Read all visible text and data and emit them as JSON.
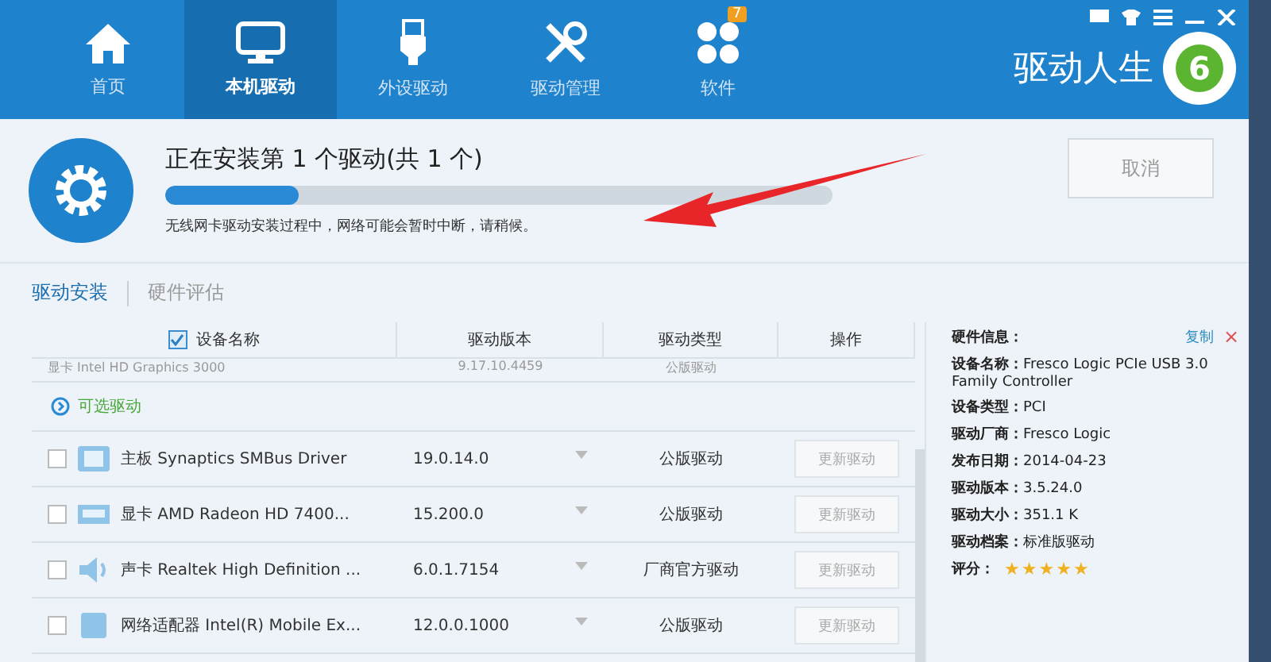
{
  "nav": [
    {
      "label": "首页",
      "kind": "home",
      "selected": false
    },
    {
      "label": "本机驱动",
      "kind": "monitor",
      "selected": true
    },
    {
      "label": "外设驱动",
      "kind": "usb",
      "selected": false
    },
    {
      "label": "驱动管理",
      "kind": "tools",
      "selected": false
    },
    {
      "label": "软件",
      "kind": "apps",
      "selected": false,
      "badge": "7"
    }
  ],
  "brand": {
    "name": "驱动人生",
    "logo_text": "6"
  },
  "install": {
    "title": "正在安装第 1 个驱动(共 1 个)",
    "level": 0.2,
    "note": "无线网卡驱动安装过程中，网络可能会暂时中断，请稍候。",
    "cancel": "取消"
  },
  "tabs": [
    {
      "label": "驱动安装",
      "selected": true
    },
    {
      "label": "硬件评估",
      "selected": false
    }
  ],
  "table": {
    "header_checked": true,
    "columns": [
      "设备名称",
      "驱动版本",
      "驱动类型",
      "操作"
    ],
    "partial_row": {
      "name": "显卡 Intel HD Graphics 3000",
      "version": "9.17.10.4459",
      "type": "公版驱动"
    },
    "group": "可选驱动",
    "rows": [
      {
        "kind": "board",
        "name": "主板 Synaptics SMBus Driver",
        "version": "19.0.14.0",
        "type": "公版驱动",
        "action": "更新驱动",
        "checked": false
      },
      {
        "kind": "display",
        "name": "显卡 AMD Radeon HD 7400...",
        "version": "15.200.0",
        "type": "公版驱动",
        "action": "更新驱动",
        "checked": false
      },
      {
        "kind": "speaker",
        "name": "声卡 Realtek High Definition ...",
        "version": "6.0.1.7154",
        "type": "厂商官方驱动",
        "action": "更新驱动",
        "checked": false
      },
      {
        "kind": "network",
        "name": "网络适配器 Intel(R) Mobile Ex...",
        "version": "12.0.0.1000",
        "type": "公版驱动",
        "action": "更新驱动",
        "checked": false
      }
    ]
  },
  "info": {
    "title": "硬件信息：",
    "copy": "复制",
    "close": "×",
    "fields": [
      {
        "label": "设备名称：",
        "value": "Fresco Logic PCIe USB 3.0 Family Controller"
      },
      {
        "label": "设备类型：",
        "value": "PCI"
      },
      {
        "label": "驱动厂商：",
        "value": "Fresco Logic"
      },
      {
        "label": "发布日期：",
        "value": "2014-04-23"
      },
      {
        "label": "驱动版本：",
        "value": "3.5.24.0"
      },
      {
        "label": "驱动大小：",
        "value": "351.1 K"
      },
      {
        "label": "驱动档案：",
        "value": "标准版驱动"
      }
    ],
    "rating_label": "评分：",
    "stars": 5
  }
}
